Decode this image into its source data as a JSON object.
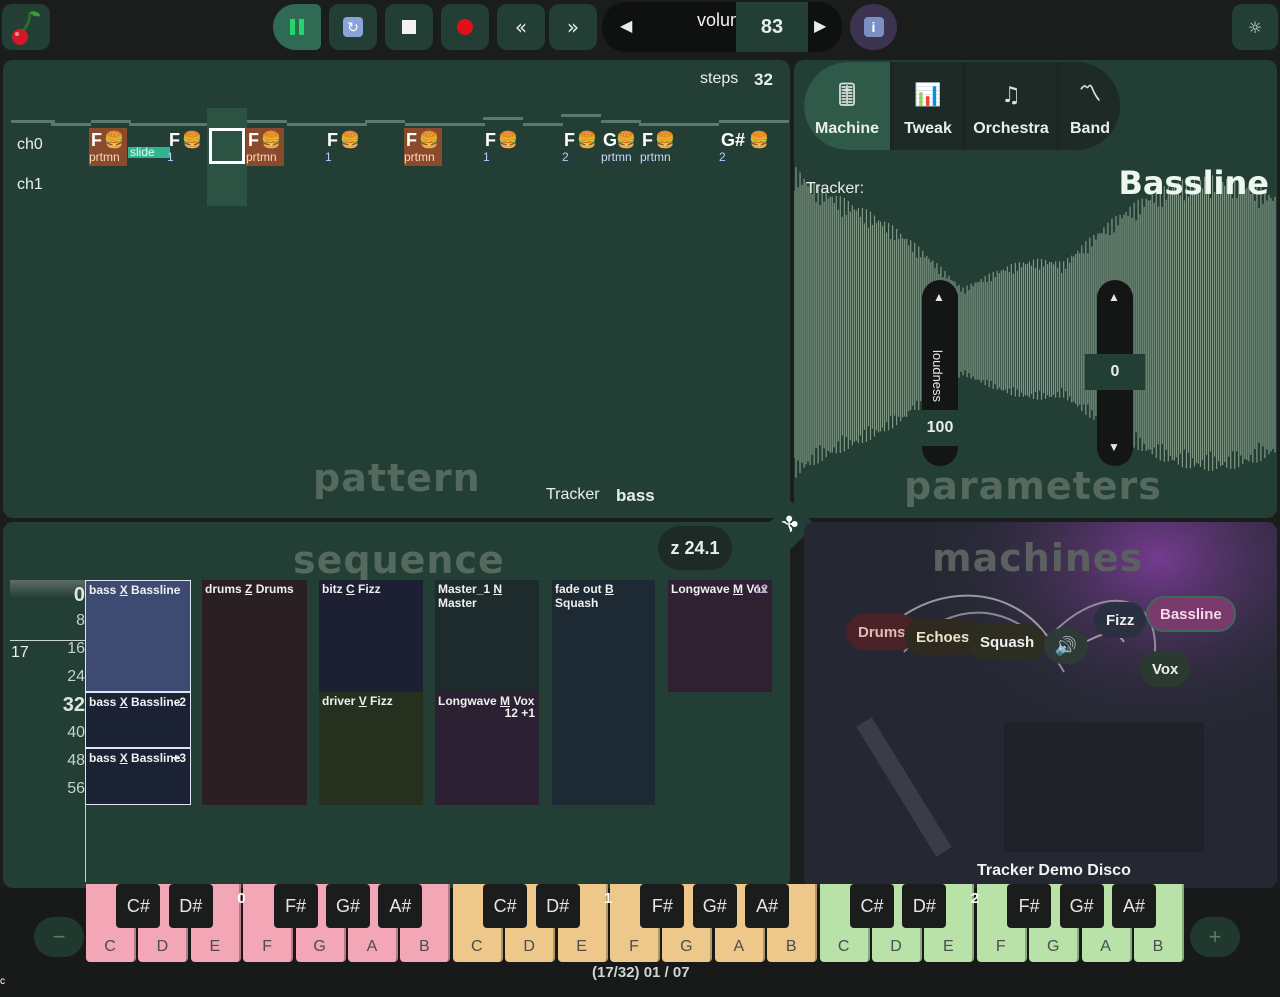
{
  "toolbar": {
    "volume_label": "volum",
    "volume_value": "83"
  },
  "pattern": {
    "steps_label": "steps",
    "steps_value": "32",
    "channels": [
      "ch0",
      "ch1"
    ],
    "notes": [
      {
        "name": "F",
        "sub": "prtmn",
        "hl": true
      },
      {
        "name": "F",
        "sub": "1",
        "hl": false
      },
      {
        "name": "F",
        "sub": "prtmn",
        "hl": true
      },
      {
        "name": "F",
        "sub": "1",
        "hl": false
      },
      {
        "name": "F",
        "sub": "prtmn",
        "hl": true
      },
      {
        "name": "F",
        "sub": "1",
        "hl": false
      },
      {
        "name": "F",
        "sub": "2",
        "hl": false
      },
      {
        "name": "G",
        "sub": "prtmn",
        "hl": false
      },
      {
        "name": "F",
        "sub": "prtmn",
        "hl": false
      },
      {
        "name": "G#",
        "sub": "2",
        "hl": false
      }
    ],
    "slide_label": "slide",
    "tracker_label": "Tracker",
    "tracker_name": "bass",
    "watermark": "pattern"
  },
  "parameters": {
    "tabs": [
      {
        "label": "Machine",
        "icon": "machine-icon"
      },
      {
        "label": "Tweak",
        "icon": "tweak-icon"
      },
      {
        "label": "Orchestra",
        "icon": "orchestra-icon"
      },
      {
        "label": "Band",
        "icon": "band-icon"
      }
    ],
    "tracker_label": "Tracker:",
    "title": "Bassline",
    "loudness_label": "loudness",
    "loudness_value": "100",
    "second_value": "0",
    "watermark": "parameters"
  },
  "sequence": {
    "watermark": "sequence",
    "zoom": "z 24.1",
    "row_numbers": [
      "0",
      "8",
      "16",
      "24",
      "32",
      "40",
      "48",
      "56"
    ],
    "current_row": "17",
    "blocks": [
      {
        "pre": "bass ",
        "key": "X",
        "post": " Bassline",
        "right": "",
        "r2": ""
      },
      {
        "pre": "bass ",
        "key": "X",
        "post": " Bassline",
        "right": "-2",
        "r2": ""
      },
      {
        "pre": "bass ",
        "key": "X",
        "post": " Bassline",
        "right": "+3",
        "r2": ""
      },
      {
        "pre": "drums ",
        "key": "Z",
        "post": " Drums",
        "right": "",
        "r2": ""
      },
      {
        "pre": "bitz ",
        "key": "C",
        "post": " Fizz",
        "right": "",
        "r2": ""
      },
      {
        "pre": "driver ",
        "key": "V",
        "post": " Fizz",
        "right": "",
        "r2": ""
      },
      {
        "pre": "Master_1 ",
        "key": "N",
        "post": " Master",
        "right": "",
        "r2": ""
      },
      {
        "pre": "Longwave ",
        "key": "M",
        "post": " Vox",
        "right": "",
        "r2": "12 +1"
      },
      {
        "pre": "fade out ",
        "key": "B",
        "post": " Squash",
        "right": "",
        "r2": ""
      },
      {
        "pre": "Longwave ",
        "key": "M",
        "post": " Vox",
        "right": "12",
        "r2": ""
      }
    ]
  },
  "machines": {
    "watermark": "machines",
    "nodes": [
      "Drums",
      "Echoes",
      "Squash",
      "Fizz",
      "Bassline",
      "Vox"
    ],
    "caption": "Tracker Demo Disco"
  },
  "keyboard": {
    "white_keys": [
      "C",
      "D",
      "E",
      "F",
      "G",
      "A",
      "B",
      "C",
      "D",
      "E",
      "F",
      "G",
      "A",
      "B",
      "C",
      "D",
      "E",
      "F",
      "G",
      "A",
      "B"
    ],
    "black_keys": [
      "C#",
      "D#",
      "F#",
      "G#",
      "A#",
      "C#",
      "D#",
      "F#",
      "G#",
      "A#",
      "C#",
      "D#",
      "F#",
      "G#",
      "A#"
    ],
    "octaves": [
      "0",
      "1",
      "2"
    ],
    "minus": "−",
    "plus": "+",
    "position": "(17/32) 01 / 07"
  },
  "colors": {
    "panel": "#233e35",
    "octave0": "#f2a6b6",
    "octave1": "#edc88a",
    "octave2": "#b8e2a8"
  }
}
